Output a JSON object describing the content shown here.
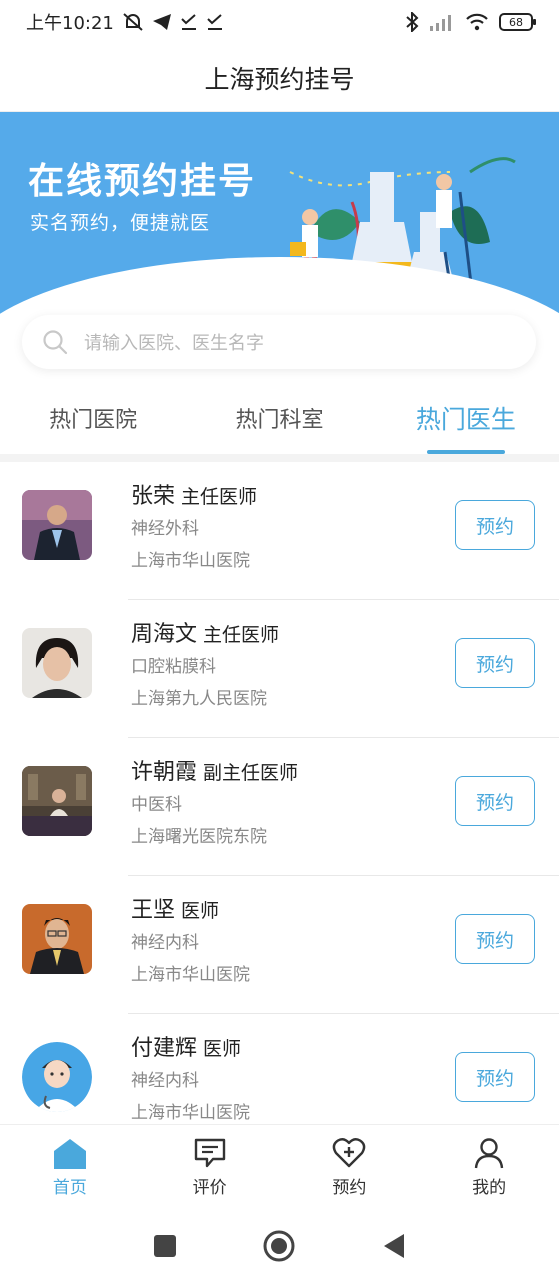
{
  "status_bar": {
    "time": "上午10:21",
    "battery": "68",
    "icons": [
      "mute-bell-icon",
      "telegram-icon",
      "check-download-icon",
      "check-download-icon",
      "bluetooth-icon",
      "signal-icon",
      "wifi-icon",
      "battery-icon"
    ]
  },
  "header": {
    "title": "上海预约挂号"
  },
  "banner": {
    "title": "在线预约挂号",
    "subtitle": "实名预约，便捷就医",
    "background_color": "#55aaea"
  },
  "search": {
    "placeholder": "请输入医院、医生名字"
  },
  "tabs": [
    {
      "label": "热门医院",
      "active": false
    },
    {
      "label": "热门科室",
      "active": false
    },
    {
      "label": "热门医生",
      "active": true
    }
  ],
  "doctors": [
    {
      "name": "张荣",
      "title": "主任医师",
      "dept": "神经外科",
      "hospital": "上海市华山医院",
      "book_label": "预约",
      "avatar": "man-suit-photo"
    },
    {
      "name": "周海文",
      "title": "主任医师",
      "dept": "口腔粘膜科",
      "hospital": "上海第九人民医院",
      "book_label": "预约",
      "avatar": "woman-photo"
    },
    {
      "name": "许朝霞",
      "title": "副主任医师",
      "dept": "中医科",
      "hospital": "上海曙光医院东院",
      "book_label": "预约",
      "avatar": "woman-desk-photo"
    },
    {
      "name": "王坚",
      "title": "医师",
      "dept": "神经内科",
      "hospital": "上海市华山医院",
      "book_label": "预约",
      "avatar": "man-glasses-photo"
    },
    {
      "name": "付建辉",
      "title": "医师",
      "dept": "神经内科",
      "hospital": "上海市华山医院",
      "book_label": "预约",
      "avatar": "doctor-cartoon-avatar"
    }
  ],
  "bottom_nav": [
    {
      "label": "首页",
      "icon": "home-icon",
      "active": true
    },
    {
      "label": "评价",
      "icon": "comment-icon",
      "active": false
    },
    {
      "label": "预约",
      "icon": "heart-plus-icon",
      "active": false
    },
    {
      "label": "我的",
      "icon": "user-icon",
      "active": false
    }
  ],
  "colors": {
    "accent": "#4aa8dc",
    "banner": "#55aaea"
  }
}
